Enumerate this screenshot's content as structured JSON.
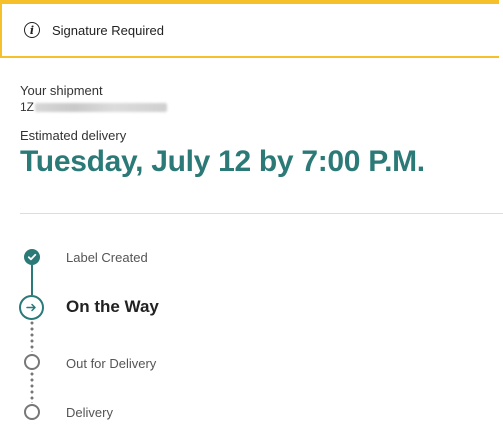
{
  "alert": {
    "icon": "info-icon",
    "text": "Signature Required",
    "border_color": "#f5c02a"
  },
  "shipment": {
    "label": "Your shipment",
    "tracking_prefix": "1Z",
    "estimated_label": "Estimated delivery",
    "delivery_date": "Tuesday, July 12 by 7:00 P.M.",
    "accent_color": "#2b7a78"
  },
  "progress": {
    "steps": [
      {
        "label": "Label Created",
        "status": "complete",
        "icon": "check-icon"
      },
      {
        "label": "On the Way",
        "status": "current",
        "icon": "arrow-right-icon"
      },
      {
        "label": "Out for Delivery",
        "status": "pending",
        "icon": "circle-icon"
      },
      {
        "label": "Delivery",
        "status": "pending",
        "icon": "circle-icon"
      }
    ]
  }
}
